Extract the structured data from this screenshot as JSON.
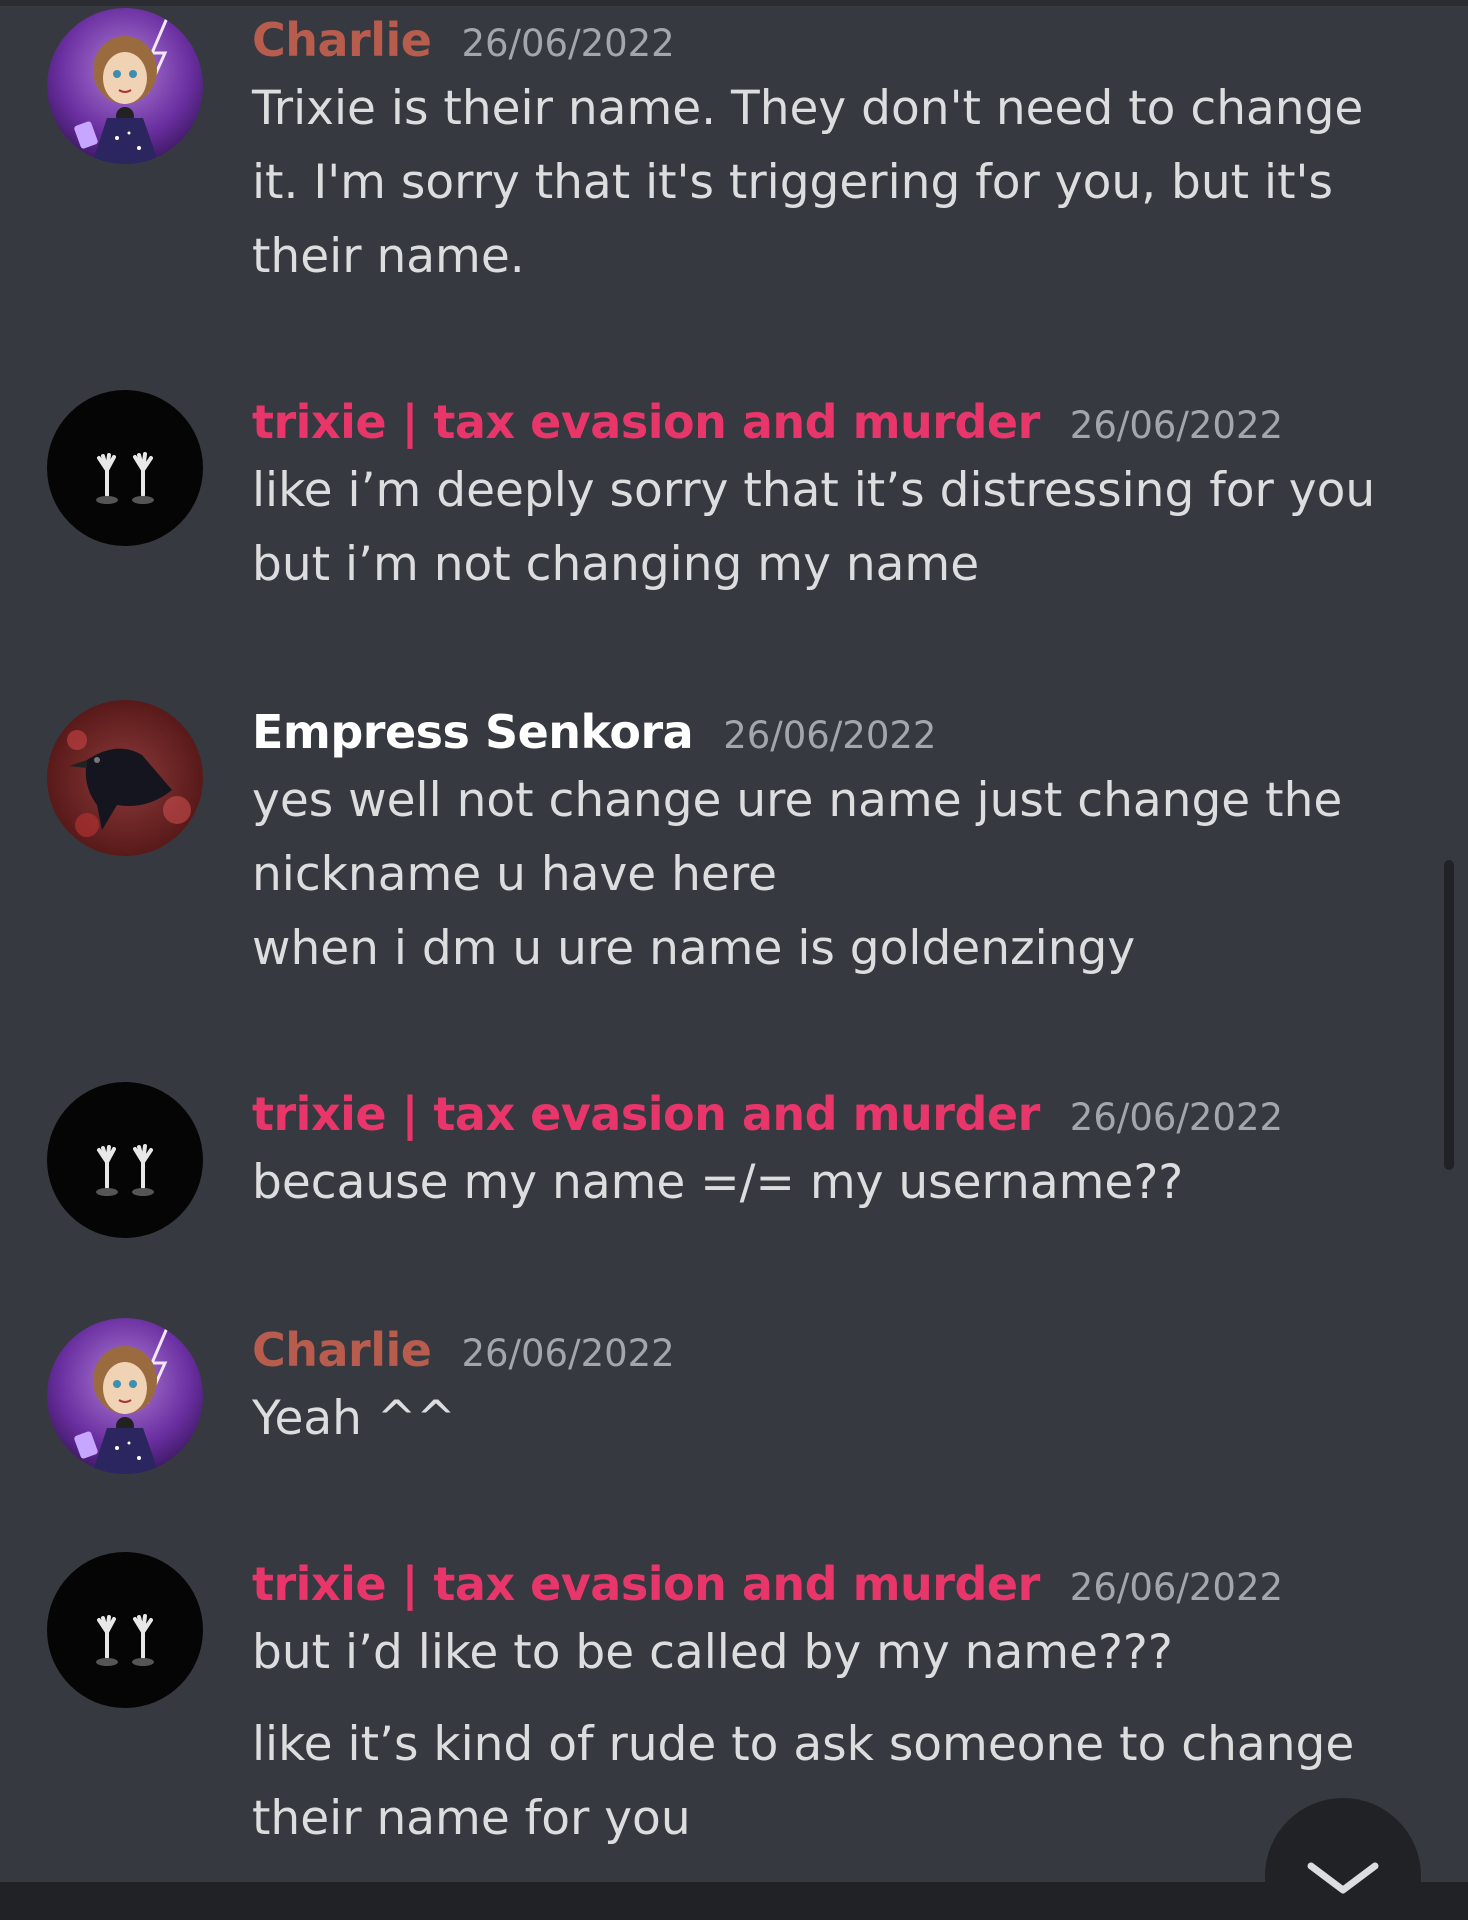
{
  "colors": {
    "background": "#36393f",
    "charlie": "#b85c4e",
    "trixie": "#e8366b",
    "empress": "#ffffff",
    "text": "#dcddde",
    "timestamp": "#a3a6aa"
  },
  "messages": [
    {
      "author": "Charlie",
      "timestamp": "26/06/2022",
      "avatar": "charlie-avatar",
      "lines": [
        "Trixie is their name. They don't need to change",
        "it. I'm sorry that it's triggering for you, but it's",
        "their name."
      ]
    },
    {
      "author": "trixie | tax evasion and murder",
      "timestamp": "26/06/2022",
      "avatar": "trixie-avatar",
      "lines": [
        "like i’m deeply sorry that it’s distressing for you",
        "but i’m not changing my name"
      ]
    },
    {
      "author": "Empress Senkora",
      "timestamp": "26/06/2022",
      "avatar": "empress-avatar",
      "lines": [
        "yes well not change ure name just change the",
        "nickname u have here",
        "when i dm u ure name is goldenzingy"
      ]
    },
    {
      "author": "trixie | tax evasion and murder",
      "timestamp": "26/06/2022",
      "avatar": "trixie-avatar",
      "lines": [
        "because my name =/= my username??"
      ]
    },
    {
      "author": "Charlie",
      "timestamp": "26/06/2022",
      "avatar": "charlie-avatar",
      "lines": [
        "Yeah ^^"
      ]
    },
    {
      "author": "trixie | tax evasion and murder",
      "timestamp": "26/06/2022",
      "avatar": "trixie-avatar",
      "lines": [
        "but i’d like to be called by my name???",
        "like it’s kind of rude to ask someone to change",
        "their name for you"
      ]
    }
  ],
  "jump_button_icon": "chevron-down-icon"
}
